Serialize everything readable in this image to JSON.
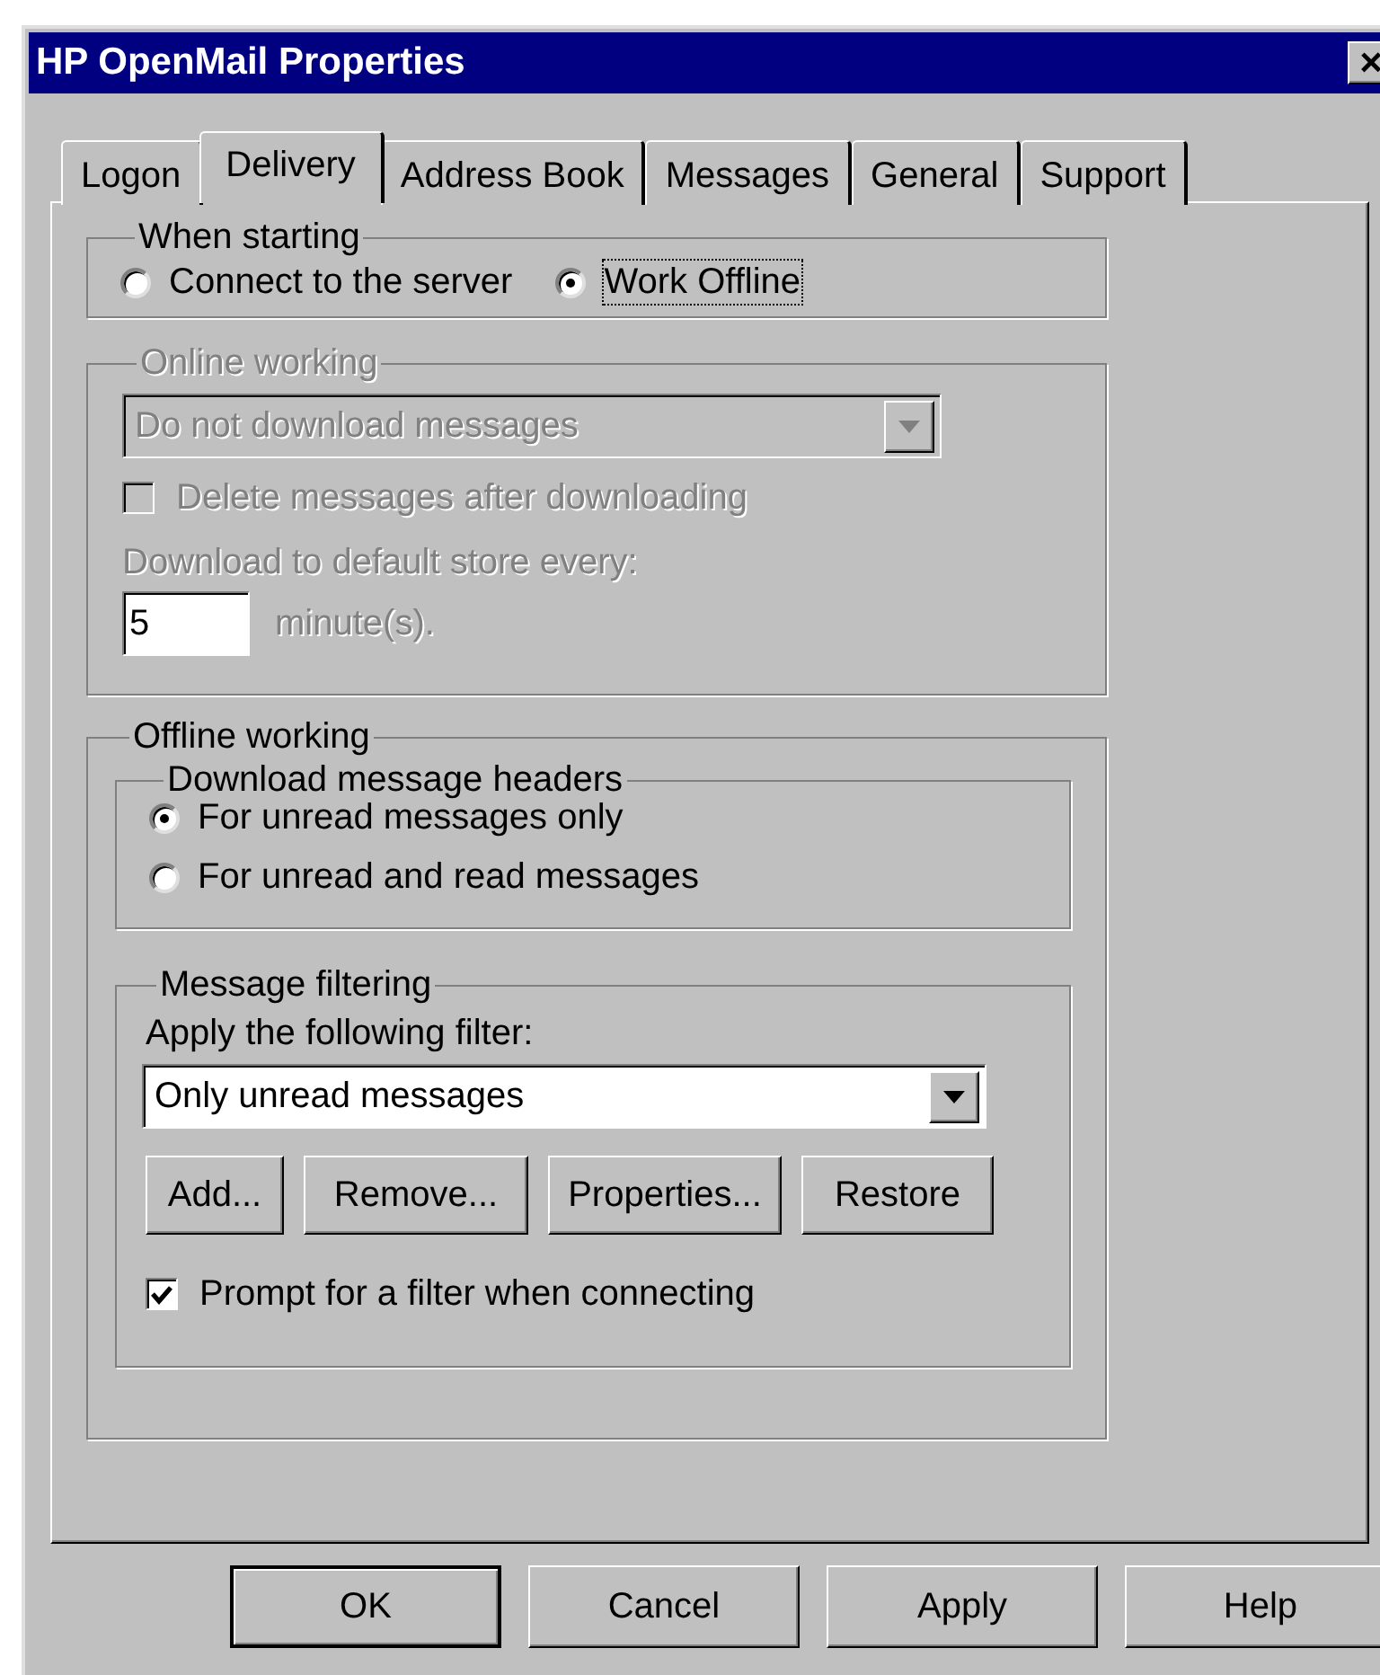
{
  "window": {
    "title": "HP OpenMail Properties",
    "close": "×"
  },
  "tabs": [
    {
      "label": "Logon",
      "selected": false
    },
    {
      "label": "Delivery",
      "selected": true
    },
    {
      "label": "Address Book",
      "selected": false
    },
    {
      "label": "Messages",
      "selected": false
    },
    {
      "label": "General",
      "selected": false
    },
    {
      "label": "Support",
      "selected": false
    }
  ],
  "when_starting": {
    "title": "When starting",
    "options": [
      {
        "label": "Connect to the server",
        "selected": false,
        "focused": false
      },
      {
        "label": "Work Offline",
        "selected": true,
        "focused": true
      }
    ]
  },
  "online_working": {
    "title": "Online working",
    "disabled": true,
    "download_mode": {
      "value": "Do not download messages"
    },
    "delete_after": {
      "label": "Delete messages after downloading",
      "checked": false
    },
    "interval_label": "Download to default store every:",
    "interval": {
      "value": "5"
    },
    "interval_unit": "minute(s)."
  },
  "offline_working": {
    "title": "Offline working",
    "headers": {
      "title": "Download message headers",
      "options": [
        {
          "label": "For unread messages only",
          "selected": true
        },
        {
          "label": "For unread and read messages",
          "selected": false
        }
      ]
    },
    "filtering": {
      "title": "Message filtering",
      "filter_label": "Apply the following filter:",
      "filter": {
        "value": "Only unread messages"
      },
      "buttons": [
        "Add...",
        "Remove...",
        "Properties...",
        "Restore"
      ],
      "prompt": {
        "label": "Prompt for a filter when connecting",
        "checked": true
      }
    }
  },
  "buttons": [
    {
      "label": "OK",
      "default": true
    },
    {
      "label": "Cancel",
      "default": false
    },
    {
      "label": "Apply",
      "default": false
    },
    {
      "label": "Help",
      "default": false
    }
  ]
}
